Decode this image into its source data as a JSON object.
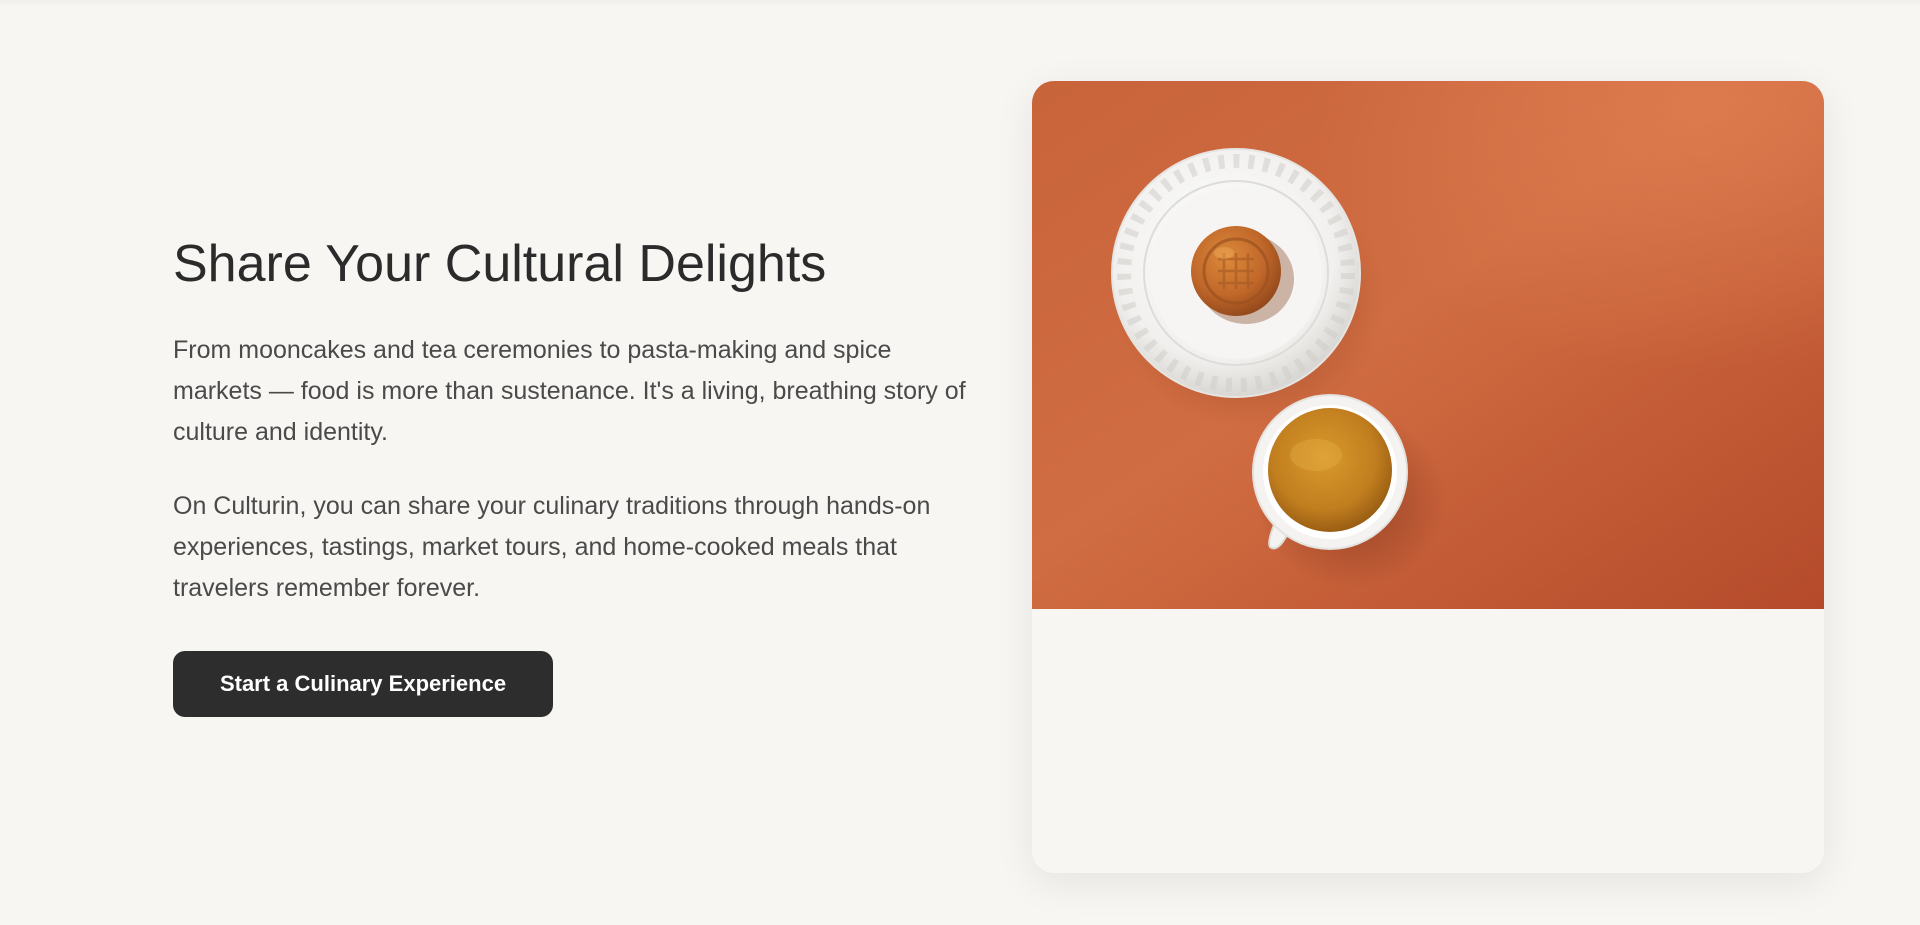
{
  "hero": {
    "title": "Share Your Cultural Delights",
    "paragraph_1": "From mooncakes and tea ceremonies to pasta-making and spice markets — food is more than sustenance. It's a living, breathing story of culture and identity.",
    "paragraph_2": "On Culturin, you can share your culinary traditions through hands-on experiences, tastings, market tours, and home-cooked meals that travelers remember forever.",
    "cta_label": "Start a Culinary Experience"
  },
  "image": {
    "subject": "mooncake-and-tea-photo",
    "background_color": "#c65a32"
  },
  "colors": {
    "page_background": "#f7f6f3",
    "heading": "#2b2b2b",
    "body_text": "#4a4a4a",
    "button_background": "#2d2d2d",
    "button_text": "#ffffff"
  }
}
